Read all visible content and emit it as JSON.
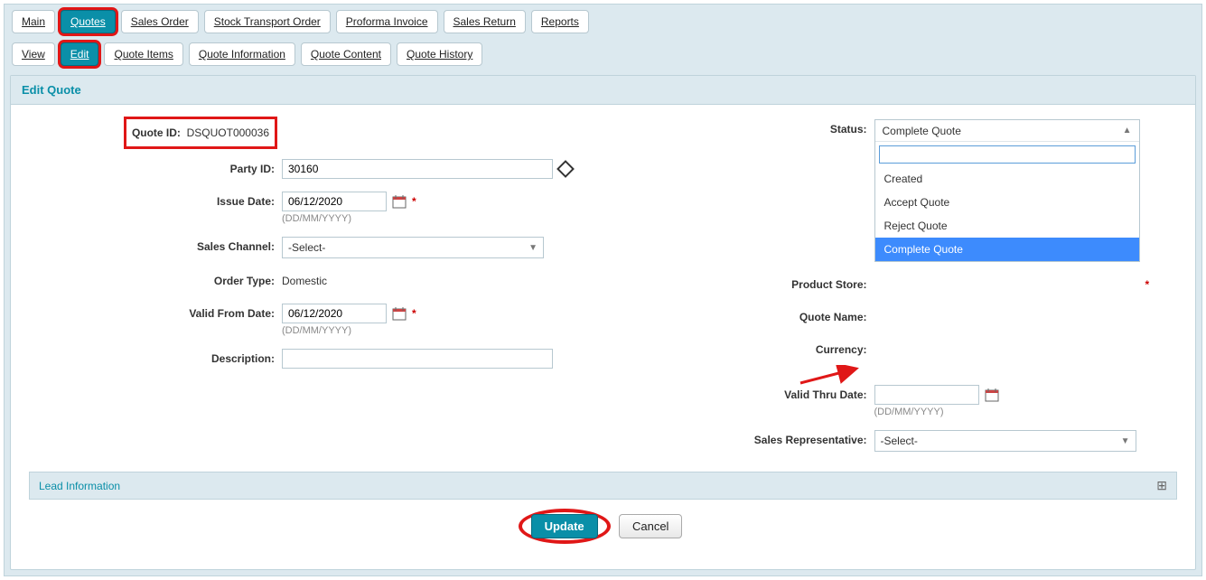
{
  "topTabs": {
    "main": "Main",
    "quotes": "Quotes",
    "salesOrder": "Sales Order",
    "stockTransport": "Stock Transport Order",
    "proforma": "Proforma Invoice",
    "salesReturn": "Sales Return",
    "reports": "Reports"
  },
  "subTabs": {
    "view": "View",
    "edit": "Edit",
    "items": "Quote Items",
    "info": "Quote Information",
    "content": "Quote Content",
    "history": "Quote History"
  },
  "panel": {
    "title": "Edit Quote"
  },
  "fields": {
    "quoteId": {
      "label": "Quote ID:",
      "value": "DSQUOT000036"
    },
    "partyId": {
      "label": "Party ID:",
      "value": "30160"
    },
    "issueDate": {
      "label": "Issue Date:",
      "value": "06/12/2020",
      "hint": "(DD/MM/YYYY)"
    },
    "salesChannel": {
      "label": "Sales Channel:",
      "value": "-Select-"
    },
    "orderType": {
      "label": "Order Type:",
      "value": "Domestic"
    },
    "validFrom": {
      "label": "Valid From Date:",
      "value": "06/12/2020",
      "hint": "(DD/MM/YYYY)"
    },
    "description": {
      "label": "Description:",
      "value": ""
    },
    "status": {
      "label": "Status:",
      "selected": "Complete Quote",
      "options": {
        "o1": "Created",
        "o2": "Accept Quote",
        "o3": "Reject Quote",
        "o4": "Complete Quote"
      }
    },
    "productStore": {
      "label": "Product Store:"
    },
    "quoteName": {
      "label": "Quote Name:"
    },
    "currency": {
      "label": "Currency:"
    },
    "validThru": {
      "label": "Valid Thru Date:",
      "value": "",
      "hint": "(DD/MM/YYYY)"
    },
    "salesRep": {
      "label": "Sales Representative:",
      "value": "-Select-"
    }
  },
  "section": {
    "lead": "Lead Information"
  },
  "buttons": {
    "update": "Update",
    "cancel": "Cancel"
  },
  "requiredMark": "*"
}
